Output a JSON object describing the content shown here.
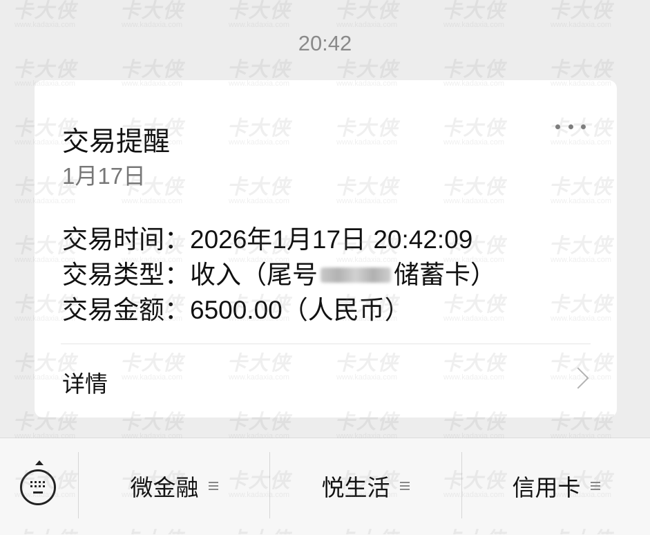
{
  "status": {
    "time": "20:42"
  },
  "message": {
    "title": "交易提醒",
    "date": "1月17日",
    "fields": [
      {
        "label": "交易时间：",
        "value": "2026年1月17日 20:42:09"
      },
      {
        "label": "交易类型：",
        "value_prefix": "收入（尾号",
        "value_suffix": "储蓄卡）"
      },
      {
        "label": "交易金额：",
        "value": "6500.00（人民币）"
      }
    ],
    "detail_link": "详情"
  },
  "menu": {
    "tabs": [
      {
        "label": "微金融"
      },
      {
        "label": "悦生活"
      },
      {
        "label": "信用卡"
      }
    ]
  },
  "watermark": {
    "logo": "卡大侠",
    "url": "www.kadaxia.com"
  },
  "colors": {
    "background": "#ededed",
    "card": "#ffffff",
    "muted_text": "#8a8a8a"
  },
  "icons": [
    "more-icon",
    "chevron-right-icon",
    "keyboard-icon",
    "menu-lines-icon"
  ]
}
